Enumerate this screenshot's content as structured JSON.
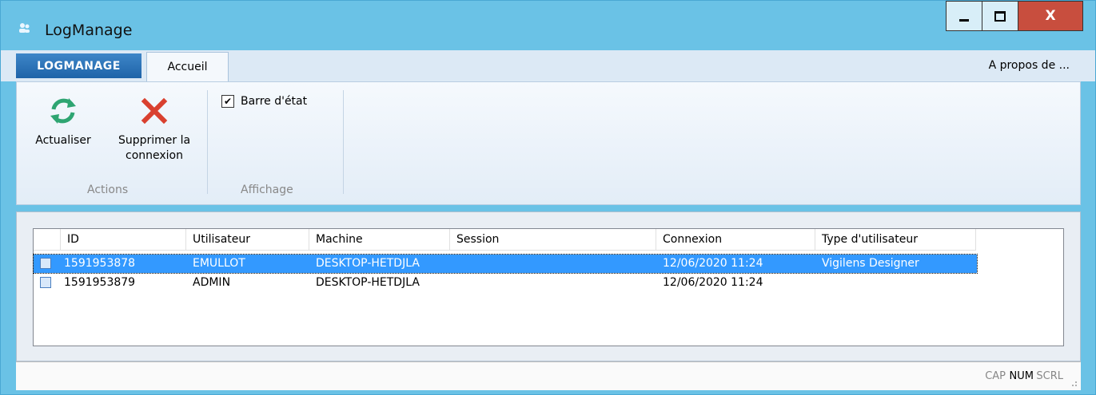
{
  "window": {
    "title": "LogManage",
    "minimize_icon": "minimize-icon",
    "maximize_icon": "maximize-icon",
    "close_label": "X"
  },
  "ribbon": {
    "app_tab": "LOGMANAGE",
    "home_tab": "Accueil",
    "about": "A propos de ...",
    "refresh_label": "Actualiser",
    "delete_label_1": "Supprimer la",
    "delete_label_2": "connexion",
    "actions_group": "Actions",
    "statusbar_check_label": "Barre d'état",
    "statusbar_checked": true,
    "display_group": "Affichage"
  },
  "grid": {
    "columns": [
      "ID",
      "Utilisateur",
      "Machine",
      "Session",
      "Connexion",
      "Type d'utilisateur"
    ],
    "rows": [
      {
        "id": "1591953878",
        "user": "EMULLOT",
        "machine": "DESKTOP-HETDJLA",
        "session": "",
        "connexion": "12/06/2020 11:24",
        "type": "Vigilens Designer",
        "selected": true,
        "icon": "designer-icon"
      },
      {
        "id": "1591953879",
        "user": "ADMIN",
        "machine": "DESKTOP-HETDJLA",
        "session": "",
        "connexion": "12/06/2020 11:24",
        "type": "",
        "selected": false,
        "icon": "admin-icon"
      }
    ]
  },
  "statusbar": {
    "cap": "CAP",
    "num": "NUM",
    "scrl": "SCRL"
  },
  "colors": {
    "titlebar": "#6ac2e6",
    "selection": "#3399ff",
    "close": "#c84e3e",
    "refresh_icon": "#2ea572",
    "delete_icon": "#d9402f"
  }
}
